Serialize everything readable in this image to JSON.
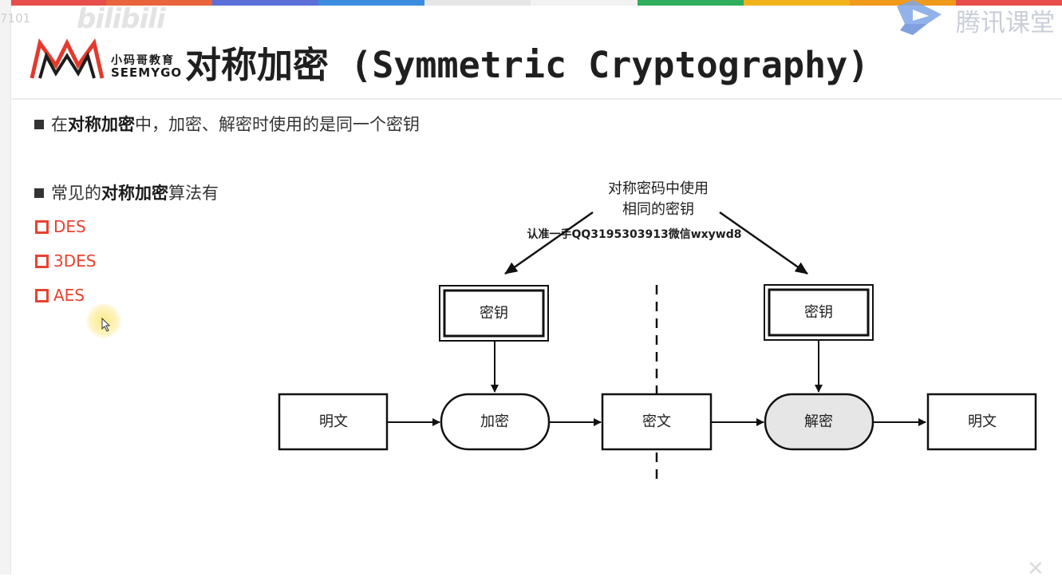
{
  "overlay": {
    "id_text": "7101",
    "bili_text": "bilibili",
    "tencent_label": "腾讯课堂"
  },
  "logo": {
    "cn": "小码哥教育",
    "en": "SEEMYGO"
  },
  "title": {
    "cn": "对称加密",
    "en": " (Symmetric Cryptography)"
  },
  "bullets": [
    {
      "pre": "在",
      "bold": "对称加密",
      "post": "中，加密、解密时使用的是同一个密钥"
    },
    {
      "pre": "常见的",
      "bold": "对称加密",
      "post": "算法有"
    }
  ],
  "algorithms": [
    "DES",
    "3DES",
    "AES"
  ],
  "diagram": {
    "note_line1": "对称密码中使用",
    "note_line2": "相同的密钥",
    "watermark": "认准一手QQ3195303913微信wxywd8",
    "key_left": "密钥",
    "key_right": "密钥",
    "plaintext_left": "明文",
    "encrypt": "加密",
    "ciphertext": "密文",
    "decrypt": "解密",
    "plaintext_right": "明文"
  },
  "colors": {
    "accent_red": "#e8432f",
    "title_text": "#1f1f1f",
    "stripe": [
      "#e84d4d",
      "#e8643a",
      "#5b6fd6",
      "#3c8de0",
      "#e6e6e6",
      "#f2f2f2",
      "#2fae5e",
      "#f2b21b",
      "#f09a1b",
      "#e84d4d"
    ]
  }
}
